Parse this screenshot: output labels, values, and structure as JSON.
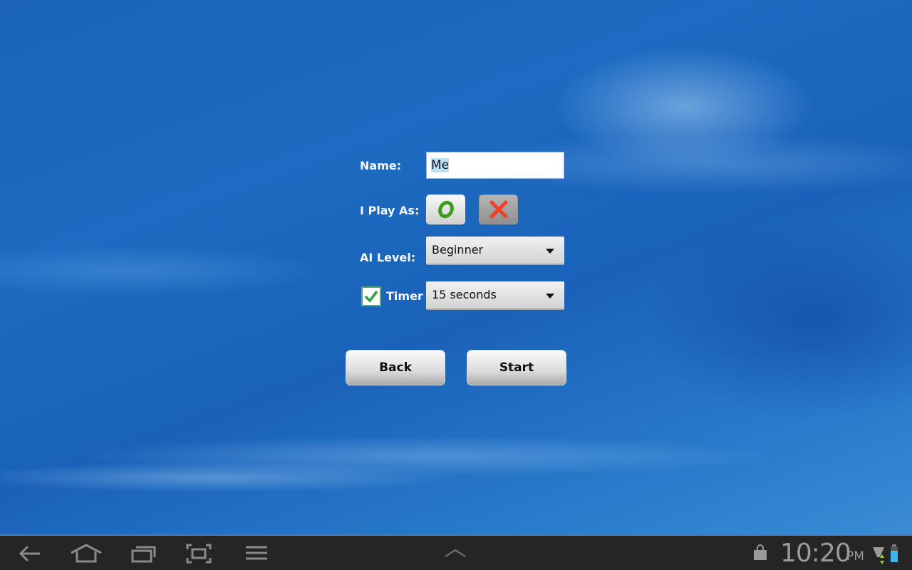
{
  "form": {
    "name_label": "Name:",
    "name_value": "Me",
    "play_as_label": "I Play As:",
    "play_as_options": [
      "O",
      "X"
    ],
    "play_as_selected": "O",
    "ai_level_label": "AI Level:",
    "ai_level_value": "Beginner",
    "timer_label": "Timer",
    "timer_checked": true,
    "timer_value": "15 seconds"
  },
  "buttons": {
    "back": "Back",
    "start": "Start"
  },
  "colors": {
    "o_mark": "#3a9e1c",
    "x_mark": "#f0402a",
    "check": "#2aa33a"
  },
  "status_bar": {
    "time": "10:20",
    "ampm": "PM",
    "icons": [
      "back-icon",
      "home-icon",
      "recent-apps-icon",
      "screenshot-icon",
      "menu-icon",
      "expand-up-icon",
      "market-icon",
      "signal-icon",
      "battery-icon"
    ]
  }
}
